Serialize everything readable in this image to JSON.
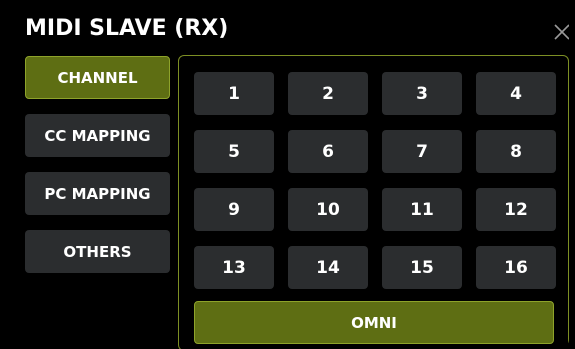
{
  "dialog": {
    "title": "MIDI SLAVE (RX)",
    "close_icon": "close-icon"
  },
  "tabs": [
    {
      "label": "CHANNEL",
      "active": true
    },
    {
      "label": "CC MAPPING",
      "active": false
    },
    {
      "label": "PC MAPPING",
      "active": false
    },
    {
      "label": "OTHERS",
      "active": false
    }
  ],
  "channels": [
    "1",
    "2",
    "3",
    "4",
    "5",
    "6",
    "7",
    "8",
    "9",
    "10",
    "11",
    "12",
    "13",
    "14",
    "15",
    "16"
  ],
  "omni": {
    "label": "OMNI",
    "selected": true
  },
  "colors": {
    "background": "#000000",
    "button": "#2b2d2f",
    "accent": "#5e6e13",
    "accent_border": "#8ea32a",
    "text": "#ffffff"
  }
}
